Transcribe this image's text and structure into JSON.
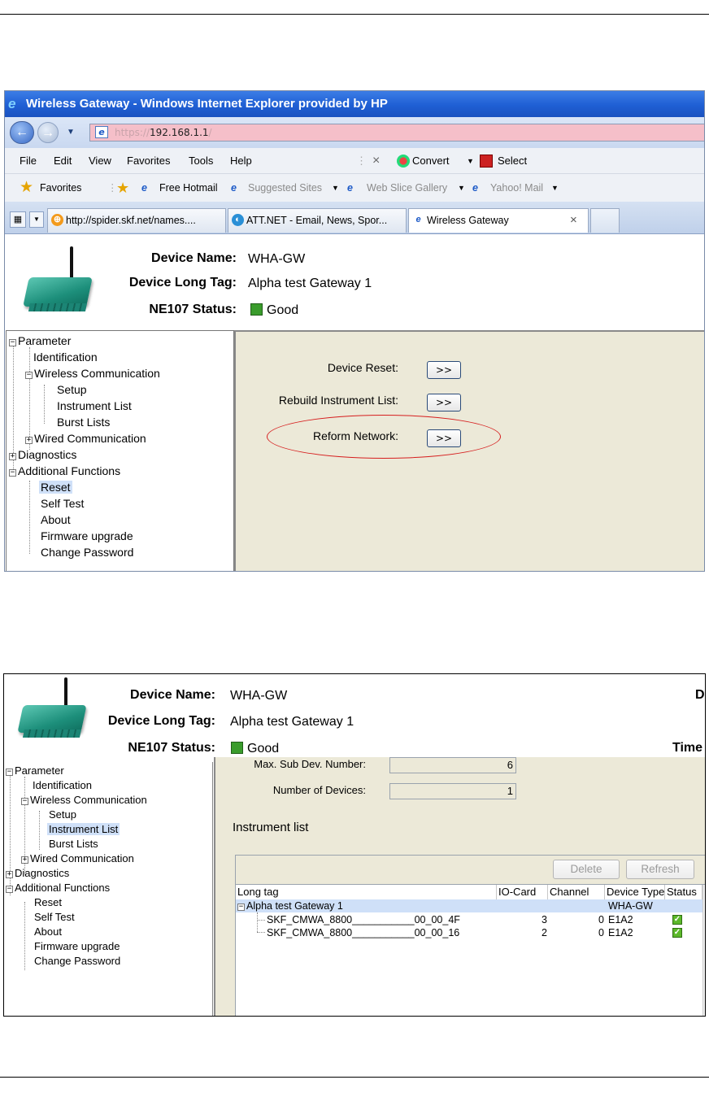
{
  "shot1": {
    "window_title": "Wireless Gateway - Windows Internet Explorer provided by HP",
    "address": {
      "protocol": "https://",
      "host": "192.168.1.1",
      "trail": "/"
    },
    "menu": [
      "File",
      "Edit",
      "View",
      "Favorites",
      "Tools",
      "Help"
    ],
    "cmd": {
      "close": "×",
      "convert": "Convert",
      "select": "Select"
    },
    "favbar": {
      "favorites": "Favorites",
      "hotmail": "Free Hotmail",
      "suggested": "Suggested Sites",
      "webslice": "Web Slice Gallery",
      "yahoo": "Yahoo! Mail"
    },
    "tabs": [
      "http://spider.skf.net/names....",
      "ATT.NET - Email, News, Spor...",
      "Wireless Gateway"
    ],
    "tab_close": "×",
    "device": {
      "name_label": "Device Name:",
      "name_value": "WHA-GW",
      "tag_label": "Device Long Tag:",
      "tag_value": "Alpha test Gateway 1",
      "status_label": "NE107 Status:",
      "status_value": "Good"
    },
    "tree": {
      "parameter": "Parameter",
      "identification": "Identification",
      "wireless": "Wireless Communication",
      "setup": "Setup",
      "instrument_list": "Instrument List",
      "burst_lists": "Burst Lists",
      "wired": "Wired Communication",
      "diagnostics": "Diagnostics",
      "additional": "Additional Functions",
      "reset": "Reset",
      "self_test": "Self Test",
      "about": "About",
      "firmware": "Firmware upgrade",
      "change_password": "Change Password"
    },
    "reset_panel": {
      "device_reset": "Device Reset:",
      "rebuild": "Rebuild Instrument List:",
      "reform": "Reform Network:",
      "button": ">>"
    }
  },
  "shot2": {
    "device": {
      "name_label": "Device Name:",
      "name_value": "WHA-GW",
      "tag_label": "Device Long Tag:",
      "tag_value": "Alpha test Gateway 1",
      "status_label": "NE107 Status:",
      "status_value": "Good",
      "right_cut_1": "D",
      "right_cut_2": "Time"
    },
    "tree": {
      "parameter": "Parameter",
      "identification": "Identification",
      "wireless": "Wireless Communication",
      "setup": "Setup",
      "instrument_list": "Instrument List",
      "burst_lists": "Burst Lists",
      "wired": "Wired Communication",
      "diagnostics": "Diagnostics",
      "additional": "Additional Functions",
      "reset": "Reset",
      "self_test": "Self Test",
      "about": "About",
      "firmware": "Firmware upgrade",
      "change_password": "Change Password"
    },
    "max_sub_label": "Max. Sub Dev. Number:",
    "max_sub_value": "6",
    "num_devices_label": "Number of Devices:",
    "num_devices_value": "1",
    "section_title": "Instrument list",
    "delete": "Delete",
    "refresh": "Refresh",
    "columns": [
      "Long tag",
      "IO-Card",
      "Channel",
      "Device Type",
      "Status"
    ],
    "gateway_row": {
      "tag": "Alpha test Gateway 1",
      "device_type": "WHA-GW"
    },
    "rows": [
      {
        "tag": "SKF_CMWA_8800___________00_00_4F",
        "io_card": "3",
        "channel": "0",
        "device_type": "E1A2"
      },
      {
        "tag": "SKF_CMWA_8800___________00_00_16",
        "io_card": "2",
        "channel": "0",
        "device_type": "E1A2"
      }
    ]
  }
}
